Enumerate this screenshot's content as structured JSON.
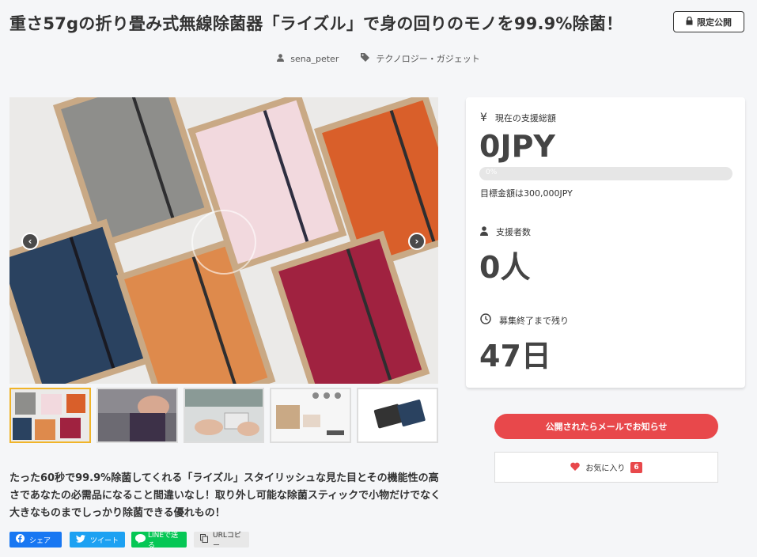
{
  "header": {
    "title": "重さ57gの折り畳み式無線除菌器「ライズル」で身の回りのモノを99.9%除菌！",
    "badge": "限定公開"
  },
  "meta": {
    "author": "sena_peter",
    "category": "テクノロジー・ガジェット"
  },
  "gallery": {
    "prev_icon": "chevron-left-icon",
    "next_icon": "chevron-right-icon",
    "thumbnail_count": 5
  },
  "stats": {
    "total_label": "現在の支援総額",
    "total_value": "0JPY",
    "progress_percent": 0,
    "progress_text": "0%",
    "goal_text": "目標金額は300,000JPY",
    "supporters_label": "支援者数",
    "supporters_value": "0人",
    "remaining_label": "募集終了まで残り",
    "remaining_value": "47日"
  },
  "actions": {
    "notify_label": "公開されたらメールでお知らせ",
    "favorite_label": "お気に入り",
    "favorite_count": "6"
  },
  "description": "たった60秒で99.9%除菌してくれる「ライズル」スタイリッシュな見た目とその機能性の高さであなたの必需品になること間違いなし！取り外し可能な除菌スティックで小物だけでなく大きなものまでしっかり除菌できる優れもの！",
  "share": {
    "facebook": "シェア",
    "twitter": "ツイート",
    "line": "LINEで送る",
    "copy": "URLコピー"
  },
  "colors": {
    "accent": "#e8484b",
    "facebook": "#1877f2",
    "twitter": "#1da1f2",
    "line": "#06c755"
  }
}
